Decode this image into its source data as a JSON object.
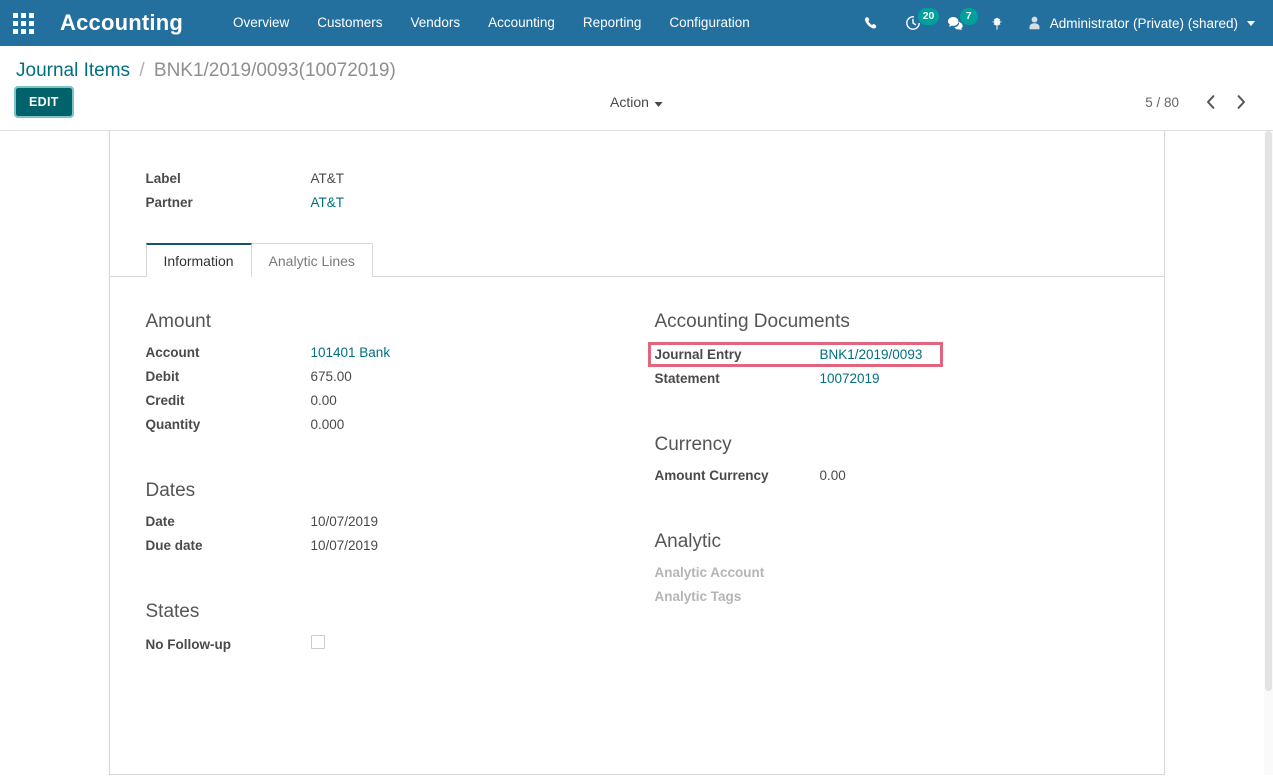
{
  "navbar": {
    "apps_icon": "apps-grid-icon",
    "brand": "Accounting",
    "menu": [
      {
        "label": "Overview"
      },
      {
        "label": "Customers"
      },
      {
        "label": "Vendors"
      },
      {
        "label": "Accounting"
      },
      {
        "label": "Reporting"
      },
      {
        "label": "Configuration"
      }
    ],
    "icons": {
      "phone": "phone-icon",
      "activity": "clock-activity-icon",
      "messages": "chat-bubble-icon",
      "debug": "bug-icon"
    },
    "activity_count": "20",
    "message_count": "7",
    "user": "Administrator (Private) (shared)",
    "background_color": "#23709e",
    "badge_color": "#00a09d"
  },
  "control_panel": {
    "breadcrumb_root": "Journal Items",
    "breadcrumb_separator": "/",
    "breadcrumb_current": "BNK1/2019/0093(10072019)",
    "edit_label": "EDIT",
    "action_label": "Action",
    "pager": "5 / 80",
    "prev_icon": "chevron-left-icon",
    "next_icon": "chevron-right-icon"
  },
  "form": {
    "header_fields": [
      {
        "label": "Label",
        "value": "AT&T",
        "is_link": false
      },
      {
        "label": "Partner",
        "value": "AT&T",
        "is_link": true
      }
    ],
    "tabs": [
      {
        "label": "Information",
        "active": true
      },
      {
        "label": "Analytic Lines",
        "active": false
      }
    ],
    "groups": {
      "amount": {
        "title": "Amount",
        "fields": [
          {
            "label": "Account",
            "value": "101401 Bank"
          },
          {
            "label": "Debit",
            "value": "675.00"
          },
          {
            "label": "Credit",
            "value": "0.00"
          },
          {
            "label": "Quantity",
            "value": "0.000"
          }
        ]
      },
      "accounting_documents": {
        "title": "Accounting Documents",
        "journal_entry_label": "Journal Entry",
        "journal_entry_value": "BNK1/2019/0093",
        "statement_label": "Statement",
        "statement_value": "10072019",
        "highlight_color": "#e2657f"
      },
      "dates": {
        "title": "Dates",
        "fields": [
          {
            "label": "Date",
            "value": "10/07/2019"
          },
          {
            "label": "Due date",
            "value": "10/07/2019"
          }
        ]
      },
      "currency": {
        "title": "Currency",
        "fields": [
          {
            "label": "Amount Currency",
            "value": "0.00"
          }
        ]
      },
      "states": {
        "title": "States",
        "no_followup_label": "No Follow-up",
        "no_followup_checked": false
      },
      "analytic": {
        "title": "Analytic",
        "account_label": "Analytic Account",
        "tags_label": "Analytic Tags"
      }
    }
  },
  "theme": {
    "link_color": "#00707f",
    "edit_button_color": "#00626b",
    "active_tab_border": "#1a5276"
  }
}
